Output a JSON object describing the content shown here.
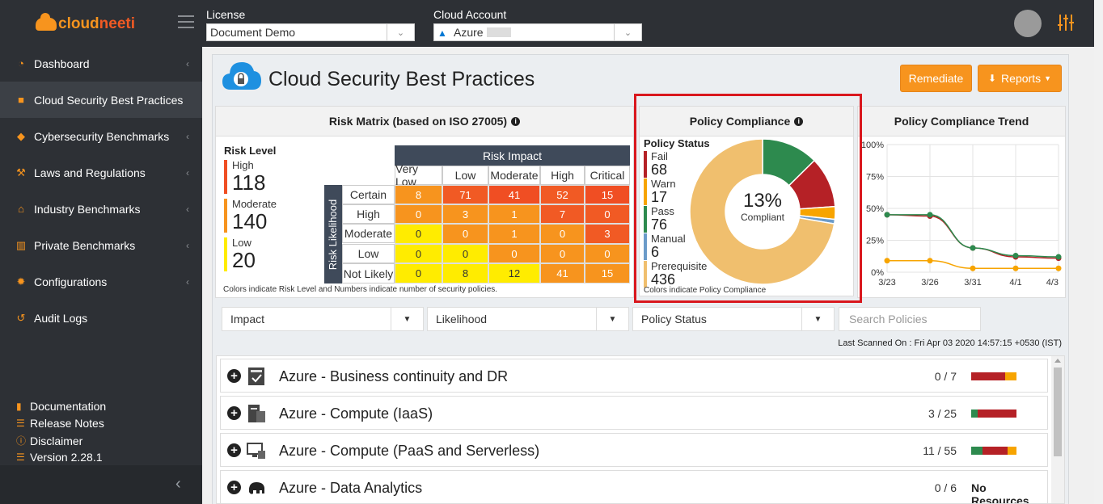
{
  "app": {
    "logo_part1": "cloud",
    "logo_part2": "neeti"
  },
  "topbar": {
    "license_label": "License",
    "license_value": "Document Demo",
    "cloud_account_label": "Cloud Account",
    "cloud_account_value": "Azure"
  },
  "sidebar": {
    "items": [
      {
        "label": "Dashboard",
        "icon": "dashboard-icon",
        "chevron": "‹"
      },
      {
        "label": "Cloud Security Best Practices",
        "icon": "briefcase-icon",
        "chevron": ""
      },
      {
        "label": "Cybersecurity Benchmarks",
        "icon": "shield-icon",
        "chevron": "‹"
      },
      {
        "label": "Laws and Regulations",
        "icon": "gavel-icon",
        "chevron": "‹"
      },
      {
        "label": "Industry Benchmarks",
        "icon": "institution-icon",
        "chevron": "‹"
      },
      {
        "label": "Private Benchmarks",
        "icon": "bar-chart-icon",
        "chevron": "‹"
      },
      {
        "label": "Configurations",
        "icon": "gear-icon",
        "chevron": "‹"
      },
      {
        "label": "Audit Logs",
        "icon": "history-icon",
        "chevron": ""
      }
    ],
    "footer": [
      {
        "label": "Documentation",
        "icon": "book-icon"
      },
      {
        "label": "Release Notes",
        "icon": "list-icon"
      },
      {
        "label": "Disclaimer",
        "icon": "exclamation-icon"
      },
      {
        "label": "Version 2.28.1",
        "icon": "list-icon"
      }
    ],
    "collapse_glyph": "‹"
  },
  "page": {
    "title": "Cloud Security Best Practices",
    "remediate_label": "Remediate",
    "reports_label": "Reports"
  },
  "risk_matrix": {
    "title": "Risk Matrix (based on ISO 27005)",
    "risk_level_title": "Risk Level",
    "levels": [
      {
        "label": "High",
        "value": "118",
        "color": "#f04e23"
      },
      {
        "label": "Moderate",
        "value": "140",
        "color": "#f7941e"
      },
      {
        "label": "Low",
        "value": "20",
        "color": "#ffec00"
      }
    ],
    "impact_header": "Risk Impact",
    "likelihood_header": "Risk Likelihood",
    "impact_columns": [
      "Very Low",
      "Low",
      "Moderate",
      "High",
      "Critical"
    ],
    "rows": [
      {
        "label": "Certain",
        "values": [
          "8",
          "71",
          "41",
          "52",
          "15"
        ]
      },
      {
        "label": "High",
        "values": [
          "0",
          "3",
          "1",
          "7",
          "0"
        ]
      },
      {
        "label": "Moderate",
        "values": [
          "0",
          "0",
          "1",
          "0",
          "3"
        ]
      },
      {
        "label": "Low",
        "values": [
          "0",
          "0",
          "0",
          "0",
          "0"
        ]
      },
      {
        "label": "Not Likely",
        "values": [
          "0",
          "8",
          "12",
          "41",
          "15"
        ]
      }
    ],
    "note": "Colors indicate Risk Level and Numbers indicate number of security policies."
  },
  "policy_compliance": {
    "title": "Policy Compliance",
    "status_title": "Policy Status",
    "statuses": [
      {
        "label": "Fail",
        "value": "68",
        "color": "#b52126"
      },
      {
        "label": "Warn",
        "value": "17",
        "color": "#f7a400"
      },
      {
        "label": "Pass",
        "value": "76",
        "color": "#2d8a4e"
      },
      {
        "label": "Manual",
        "value": "6",
        "color": "#6b9bc9"
      },
      {
        "label": "Prerequisite",
        "value": "436",
        "color": "#f0bf6e"
      }
    ],
    "percent": "13%",
    "percent_label": "Compliant",
    "note": "Colors indicate Policy Compliance"
  },
  "trend": {
    "title": "Policy Compliance Trend"
  },
  "chart_data": {
    "type": "line",
    "title": "Policy Compliance Trend",
    "x": [
      "3/23",
      "3/26",
      "3/31",
      "4/1",
      "4/3"
    ],
    "yticks": [
      "0%",
      "25%",
      "50%",
      "75%",
      "100%"
    ],
    "ylim": [
      0,
      100
    ],
    "grid": true,
    "series": [
      {
        "color": "#b52126",
        "values": [
          45,
          44,
          19,
          12,
          11
        ]
      },
      {
        "color": "#2d8a4e",
        "values": [
          45,
          45,
          19,
          13,
          12
        ]
      },
      {
        "color": "#f7a400",
        "values": [
          9,
          9,
          3,
          3,
          3
        ]
      }
    ]
  },
  "filters": {
    "impact": "Impact",
    "likelihood": "Likelihood",
    "policy_status": "Policy Status",
    "search_placeholder": "Search Policies"
  },
  "last_scanned": "Last Scanned On : Fri Apr 03 2020 14:57:15 +0530 (IST)",
  "benchmarks": [
    {
      "name": "Azure - Business continuity and DR",
      "count": "0 / 7",
      "icon": "backup-icon",
      "bar": [
        {
          "color": "#b52126",
          "pct": 0.75
        },
        {
          "color": "#f7a400",
          "pct": 0.25
        }
      ]
    },
    {
      "name": "Azure - Compute (IaaS)",
      "count": "3 / 25",
      "icon": "server-icon",
      "bar": [
        {
          "color": "#2d8a4e",
          "pct": 0.15
        },
        {
          "color": "#b52126",
          "pct": 0.85
        }
      ]
    },
    {
      "name": "Azure - Compute (PaaS and Serverless)",
      "count": "11 / 55",
      "icon": "monitor-icon",
      "bar": [
        {
          "color": "#2d8a4e",
          "pct": 0.25
        },
        {
          "color": "#b52126",
          "pct": 0.55
        },
        {
          "color": "#f7a400",
          "pct": 0.2
        }
      ]
    },
    {
      "name": "Azure - Data Analytics",
      "count": "0 / 6",
      "icon": "elephant-icon",
      "status": "No Resources"
    }
  ]
}
